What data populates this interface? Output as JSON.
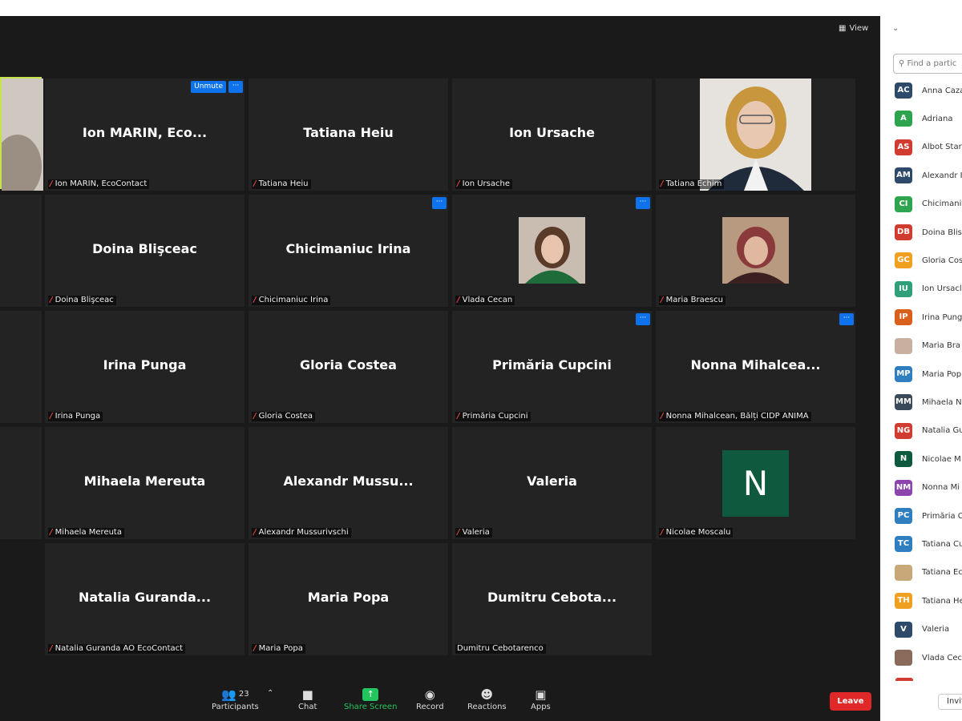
{
  "topbar": {
    "view_label": "View"
  },
  "tiles": {
    "r1c1": {
      "name": "Ion MARIN, Eco...",
      "label": "Ion MARIN, EcoContact",
      "unmute": "Unmute",
      "more": "···"
    },
    "r1c2": {
      "name": "Tatiana Heiu",
      "label": "Tatiana Heiu"
    },
    "r1c3": {
      "name": "Ion Ursache",
      "label": "Ion Ursache"
    },
    "r1c4": {
      "label": "Tatiana Echim"
    },
    "r2c1": {
      "name": "Doina Blişceac",
      "label": "Doina Blişceac"
    },
    "r2c2": {
      "name": "Chicimaniuc Irina",
      "label": "Chicimaniuc Irina",
      "more": "···"
    },
    "r2c3": {
      "label": "Vlada Cecan",
      "more": "···"
    },
    "r2c4": {
      "label": "Maria Braescu"
    },
    "r3c1": {
      "name": "Irina Punga",
      "label": "Irina Punga"
    },
    "r3c2": {
      "name": "Gloria Costea",
      "label": "Gloria Costea"
    },
    "r3c3": {
      "name": "Primăria Cupcini",
      "label": "Primăria Cupcini",
      "more": "···"
    },
    "r3c4": {
      "name": "Nonna  Mihalcea...",
      "label": "Nonna Mihalcean, Bălți CIDP ANIMA",
      "more": "···"
    },
    "r4c1": {
      "name": "Mihaela Mereuta",
      "label": "Mihaela Mereuta"
    },
    "r4c2": {
      "name": "Alexandr  Mussu...",
      "label": "Alexandr Mussurivschi"
    },
    "r4c3": {
      "name": "Valeria",
      "label": "Valeria"
    },
    "r4c4": {
      "label": "Nicolae Moscalu",
      "initial": "N"
    },
    "r5c1": {
      "name": "Natalia  Guranda...",
      "label": "Natalia Guranda AO EcoContact"
    },
    "r5c2": {
      "name": "Maria Popa",
      "label": "Maria Popa"
    },
    "r5c3": {
      "name": "Dumitru  Cebota...",
      "label": "Dumitru Cebotarenco"
    }
  },
  "toolbar": {
    "participants_label": "Participants",
    "participants_count": "23",
    "chat_label": "Chat",
    "share_label": "Share Screen",
    "record_label": "Record",
    "reactions_label": "Reactions",
    "apps_label": "Apps",
    "leave_label": "Leave"
  },
  "panel": {
    "search_placeholder": "Find a partic",
    "invite_label": "Invit",
    "participants": [
      {
        "initials": "AC",
        "name": "Anna Caza",
        "color": "#2d4a6b"
      },
      {
        "initials": "A",
        "name": "Adriana",
        "color": "#2ea44f"
      },
      {
        "initials": "AS",
        "name": "Albot Star",
        "color": "#d13b30"
      },
      {
        "initials": "AM",
        "name": "Alexandr I",
        "color": "#2d4a6b"
      },
      {
        "initials": "CI",
        "name": "Chicimanit",
        "color": "#2ea44f"
      },
      {
        "initials": "DB",
        "name": "Doina Blis",
        "color": "#d13b30"
      },
      {
        "initials": "GC",
        "name": "Gloria Cos",
        "color": "#f0a020"
      },
      {
        "initials": "IU",
        "name": "Ion Ursacl",
        "color": "#2fa07a"
      },
      {
        "initials": "IP",
        "name": "Irina Pung",
        "color": "#d9601c"
      },
      {
        "initials": "",
        "name": "Maria Bra",
        "color": "#c8b0a0"
      },
      {
        "initials": "MP",
        "name": "Maria Pop",
        "color": "#2f7fc0"
      },
      {
        "initials": "MM",
        "name": "Mihaela N",
        "color": "#3a4a5a"
      },
      {
        "initials": "NG",
        "name": "Natalia Gu",
        "color": "#d13b30"
      },
      {
        "initials": "N",
        "name": "Nicolae M",
        "color": "#0f5a3f"
      },
      {
        "initials": "NM",
        "name": "Nonna Mi",
        "color": "#8e44ad"
      },
      {
        "initials": "PC",
        "name": "Primăria C",
        "color": "#2f7fc0"
      },
      {
        "initials": "TC",
        "name": "Tatiana Cu",
        "color": "#2f7fc0"
      },
      {
        "initials": "",
        "name": "Tatiana Ec",
        "color": "#c8a878"
      },
      {
        "initials": "TH",
        "name": "Tatiana He",
        "color": "#f0a020"
      },
      {
        "initials": "V",
        "name": "Valeria",
        "color": "#2d4a6b"
      },
      {
        "initials": "",
        "name": "Vlada Cec",
        "color": "#8a6a5a"
      }
    ]
  }
}
